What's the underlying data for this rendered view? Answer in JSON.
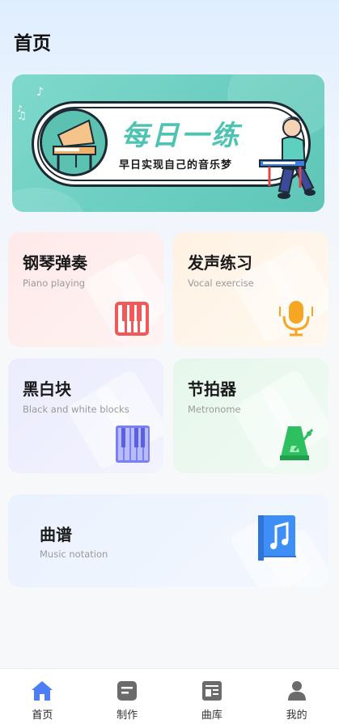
{
  "page": {
    "title": "首页"
  },
  "banner": {
    "title": "每日一练",
    "subtitle": "早日实现自己的音乐梦"
  },
  "cards": {
    "piano": {
      "title": "钢琴弹奏",
      "subtitle": "Piano playing",
      "icon": "piano-keys-icon"
    },
    "vocal": {
      "title": "发声练习",
      "subtitle": "Vocal exercise",
      "icon": "microphone-icon"
    },
    "blocks": {
      "title": "黑白块",
      "subtitle": "Black and white blocks",
      "icon": "piano-blocks-icon"
    },
    "metronome": {
      "title": "节拍器",
      "subtitle": "Metronome",
      "icon": "metronome-icon"
    },
    "notation": {
      "title": "曲谱",
      "subtitle": "Music notation",
      "icon": "music-book-icon"
    }
  },
  "tabs": [
    {
      "label": "首页",
      "icon": "home-icon",
      "active": true
    },
    {
      "label": "制作",
      "icon": "create-icon",
      "active": false
    },
    {
      "label": "曲库",
      "icon": "library-icon",
      "active": false
    },
    {
      "label": "我的",
      "icon": "profile-icon",
      "active": false
    }
  ],
  "colors": {
    "banner": "#69cdbf",
    "accent_active": "#4f7df5",
    "tab_inactive": "#6b6b6b",
    "piano_icon": "#f25858",
    "vocal_icon": "#f5a623",
    "blocks_icon": "#6b72f0",
    "metronome_icon": "#2ec060",
    "notation_icon": "#3d8ef7"
  }
}
